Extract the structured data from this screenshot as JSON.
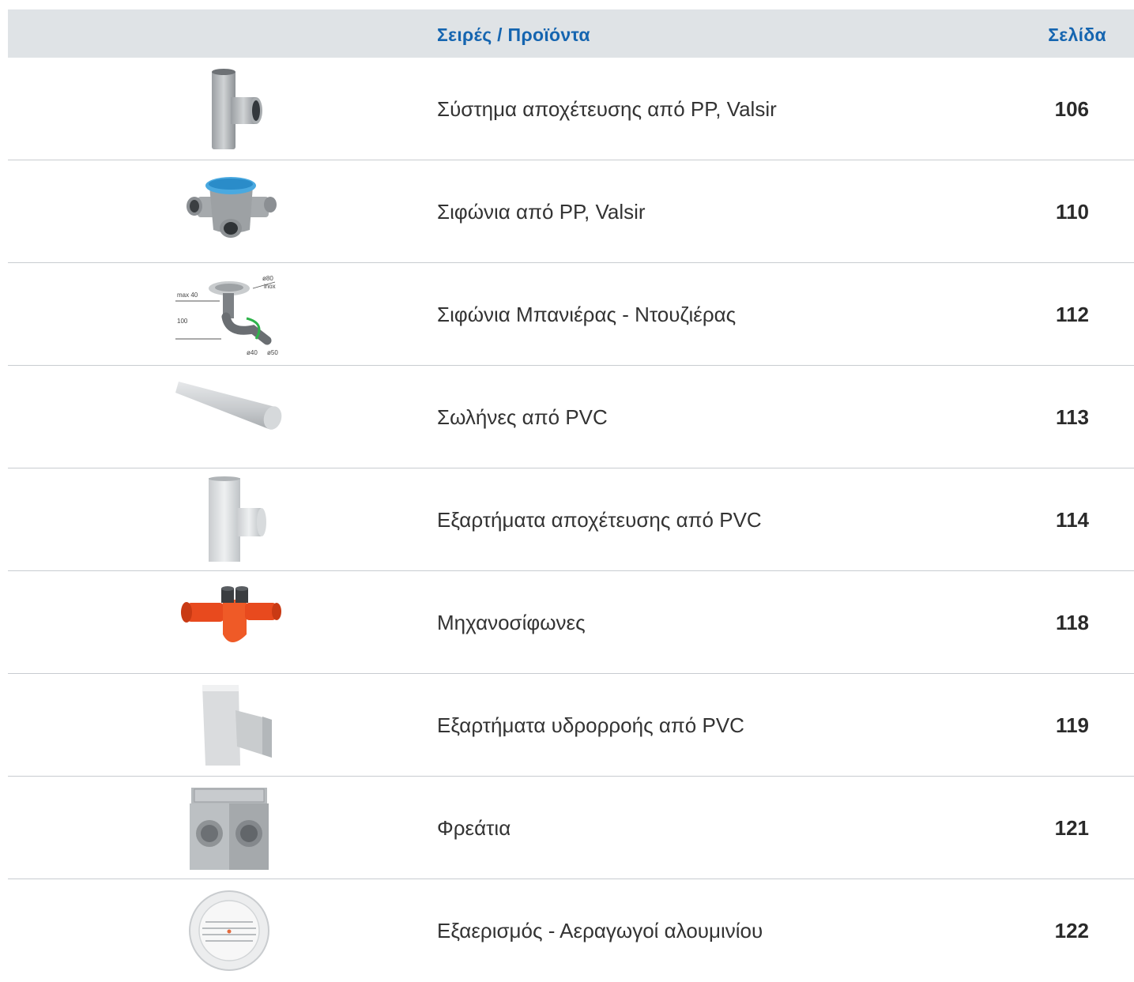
{
  "header": {
    "series_label": "Σειρές / Προϊόντα",
    "page_label": "Σελίδα"
  },
  "rows": [
    {
      "name": "Σύστημα αποχέτευσης από PP, Valsir",
      "page": "106",
      "icon": "pp-tee-fitting-icon"
    },
    {
      "name": "Σιφώνια από PP, Valsir",
      "page": "110",
      "icon": "pp-floor-drain-icon"
    },
    {
      "name": "Σιφώνια Μπανιέρας - Ντουζιέρας",
      "page": "112",
      "icon": "shower-drain-diagram-icon",
      "diagram_labels": [
        "max 40",
        "ø80",
        "inox",
        "100",
        "ø40",
        "ø50"
      ]
    },
    {
      "name": "Σωλήνες από PVC",
      "page": "113",
      "icon": "pvc-pipe-icon"
    },
    {
      "name": "Εξαρτήματα αποχέτευσης από PVC",
      "page": "114",
      "icon": "pvc-tee-fitting-icon"
    },
    {
      "name": "Μηχανοσίφωνες",
      "page": "118",
      "icon": "orange-trap-icon"
    },
    {
      "name": "Εξαρτήματα υδρορροής από PVC",
      "page": "119",
      "icon": "gutter-fitting-icon"
    },
    {
      "name": "Φρεάτια",
      "page": "121",
      "icon": "manhole-box-icon"
    },
    {
      "name": "Εξαερισμός - Αεραγωγοί αλουμινίου",
      "page": "122",
      "icon": "ventilation-fan-icon"
    }
  ]
}
